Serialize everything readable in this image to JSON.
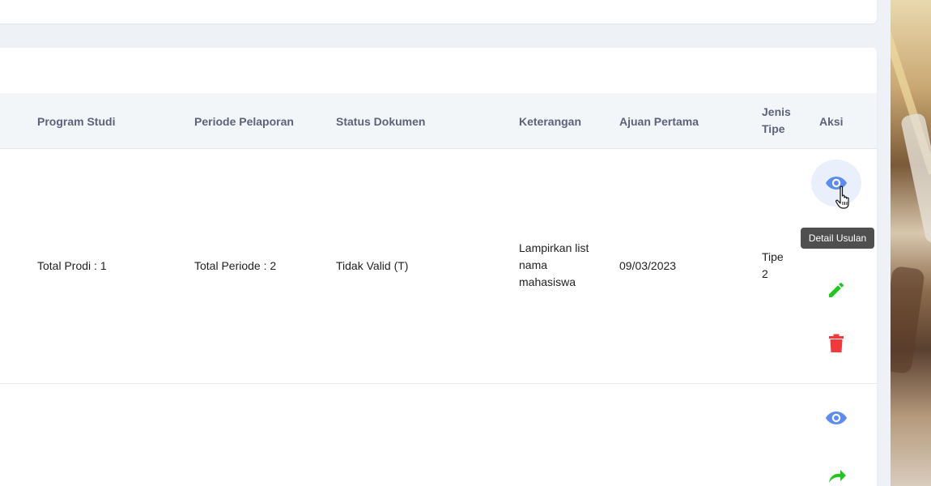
{
  "table": {
    "headers": {
      "program_studi": "Program Studi",
      "periode_pelaporan": "Periode Pelaporan",
      "status_dokumen": "Status Dokumen",
      "keterangan": "Keterangan",
      "ajuan_pertama": "Ajuan Pertama",
      "jenis_tipe_line1": "Jenis",
      "jenis_tipe_line2": "Tipe",
      "aksi": "Aksi"
    },
    "rows": [
      {
        "program_studi": "Total Prodi : 1",
        "periode_pelaporan": "Total Periode : 2",
        "status_dokumen": "Tidak Valid (T)",
        "keterangan_line1": "Lampirkan list",
        "keterangan_line2": "nama",
        "keterangan_line3": "mahasiswa",
        "ajuan_pertama": "09/03/2023",
        "jenis_tipe_line1": "Tipe",
        "jenis_tipe_line2": "2",
        "actions": [
          "eye-icon",
          "pencil-icon",
          "trash-icon"
        ]
      },
      {
        "actions": [
          "eye-icon",
          "redo-icon"
        ]
      }
    ]
  },
  "tooltip": {
    "text": "Detail Usulan"
  },
  "colors": {
    "view": "#5b8def",
    "edit": "#1fc81f",
    "delete": "#f1383d",
    "header_bg": "#f3f6f9",
    "header_text": "#5e6278"
  }
}
